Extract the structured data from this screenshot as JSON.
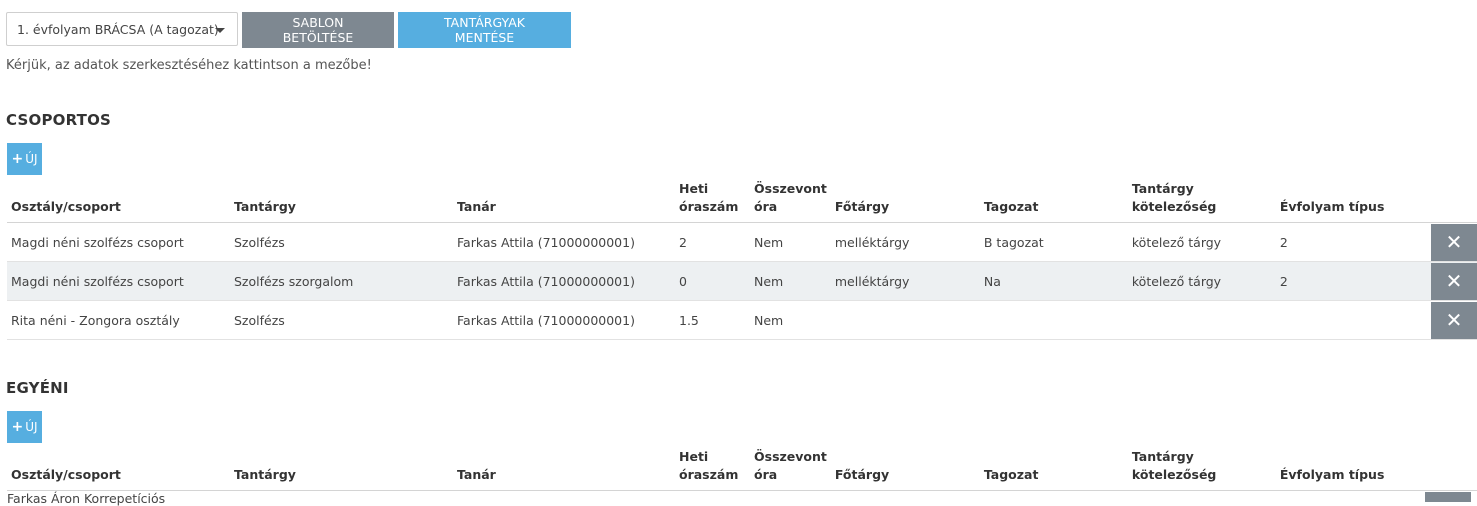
{
  "toolbar": {
    "select_value": "1. évfolyam BRÁCSA (A tagozat)",
    "load_template": "SABLON BETÖLTÉSE",
    "save_subjects": "TANTÁRGYAK MENTÉSE"
  },
  "hint": "Kérjük, az adatok szerkesztéséhez kattintson a mezőbe!",
  "columns": {
    "class": "Osztály/csoport",
    "subject": "Tantárgy",
    "teacher": "Tanár",
    "weekly_a": "Heti",
    "weekly_b": "óraszám",
    "merged_a": "Összevont",
    "merged_b": "óra",
    "main_subject": "Főtárgy",
    "department": "Tagozat",
    "obligation": "Tantárgy kötelezőség",
    "grade_type": "Évfolyam típus"
  },
  "group_section": {
    "title": "CSOPORTOS",
    "add_label": "ÚJ",
    "rows": [
      {
        "class": "Magdi néni szolfézs csoport",
        "subject": "Szolfézs",
        "teacher": "Farkas Attila (71000000001)",
        "hours": "2",
        "merged": "Nem",
        "main": "melléktárgy",
        "dept": "B tagozat",
        "oblig": "kötelező tárgy",
        "grade": "2"
      },
      {
        "class": "Magdi néni szolfézs csoport",
        "subject": "Szolfézs szorgalom",
        "teacher": "Farkas Attila (71000000001)",
        "hours": "0",
        "merged": "Nem",
        "main": "melléktárgy",
        "dept": "Na",
        "oblig": "kötelező tárgy",
        "grade": "2"
      },
      {
        "class": "Rita néni - Zongora osztály",
        "subject": "Szolfézs",
        "teacher": "Farkas Attila (71000000001)",
        "hours": "1.5",
        "merged": "Nem",
        "main": "",
        "dept": "",
        "oblig": "",
        "grade": ""
      }
    ]
  },
  "individual_section": {
    "title": "EGYÉNI",
    "add_label": "ÚJ",
    "partial_row_text": "Farkas Áron Korrepetíciós"
  },
  "icons": {
    "delete": "close-icon",
    "add": "plus-icon",
    "dropdown": "chevron-down-icon"
  },
  "colors": {
    "primary": "#56aee0",
    "secondary": "#7e8891"
  }
}
